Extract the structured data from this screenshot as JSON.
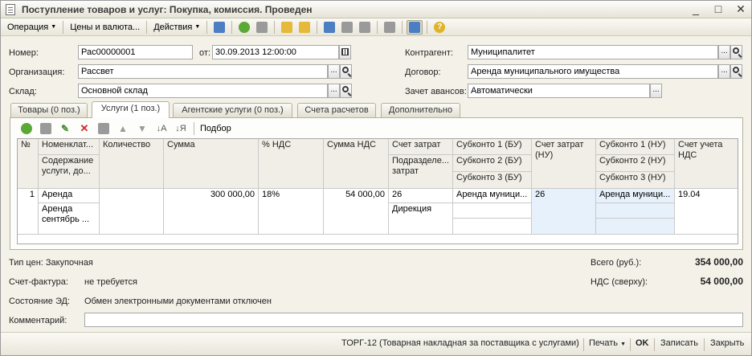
{
  "window": {
    "title": "Поступление товаров и услуг: Покупка, комиссия. Проведен"
  },
  "toolbar": {
    "operation_label": "Операция",
    "prices_label": "Цены и валюта...",
    "actions_label": "Действия"
  },
  "header": {
    "number_label": "Номер:",
    "number_value": "Рас00000001",
    "date_label": "от:",
    "date_value": "30.09.2013 12:00:00",
    "org_label": "Организация:",
    "org_value": "Рассвет",
    "warehouse_label": "Склад:",
    "warehouse_value": "Основной склад",
    "counterparty_label": "Контрагент:",
    "counterparty_value": "Муниципалитет",
    "contract_label": "Договор:",
    "contract_value": "Аренда муниципального имущества",
    "advance_label": "Зачет авансов:",
    "advance_value": "Автоматически"
  },
  "tabs": [
    {
      "label": "Товары (0 поз.)"
    },
    {
      "label": "Услуги (1 поз.)"
    },
    {
      "label": "Агентские услуги (0 поз.)"
    },
    {
      "label": "Счета расчетов"
    },
    {
      "label": "Дополнительно"
    }
  ],
  "inner_toolbar": {
    "pick_label": "Подбор"
  },
  "table": {
    "headers": {
      "n": "№",
      "nomenclature": "Номенклат...",
      "content": "Содержание услуги, до...",
      "quantity": "Количество",
      "sum": "Сумма",
      "vat_rate": "% НДС",
      "vat_sum": "Сумма НДС",
      "cost_account": "Счет затрат ...",
      "subdivision": "Подразделе... затрат",
      "subconto1_bu": "Субконто 1 (БУ)",
      "subconto2_bu": "Субконто 2 (БУ)",
      "subconto3_bu": "Субконто 3 (БУ)",
      "cost_account_nu": "Счет затрат (НУ)",
      "subconto1_nu": "Субконто 1 (НУ)",
      "subconto2_nu": "Субконто 2 (НУ)",
      "subconto3_nu": "Субконто 3 (НУ)",
      "vat_account": "Счет учета НДС"
    },
    "rows": [
      {
        "n": "1",
        "nomenclature": "Аренда",
        "content": "Аренда сентябрь ...",
        "quantity": "",
        "sum": "300 000,00",
        "vat_rate": "18%",
        "vat_sum": "54 000,00",
        "cost_account": "26",
        "subdivision": "Дирекция",
        "subconto1_bu": "Аренда муници...",
        "cost_account_nu": "26",
        "subconto1_nu": "Аренда муници...",
        "vat_account": "19.04"
      }
    ]
  },
  "summary": {
    "price_type": "Тип цен: Закупочная",
    "invoice_label": "Счет-фактура:",
    "invoice_value": "не требуется",
    "edo_label": "Состояние ЭД:",
    "edo_value": "Обмен электронными документами отключен",
    "comment_label": "Комментарий:",
    "comment_value": "",
    "total_label": "Всего (руб.):",
    "total_value": "354 000,00",
    "vat_label": "НДС (сверху):",
    "vat_value": "54 000,00"
  },
  "footer": {
    "torg12": "ТОРГ-12 (Товарная накладная за поставщика с услугами)",
    "print": "Печать",
    "ok": "OK",
    "save": "Записать",
    "close": "Закрыть"
  }
}
